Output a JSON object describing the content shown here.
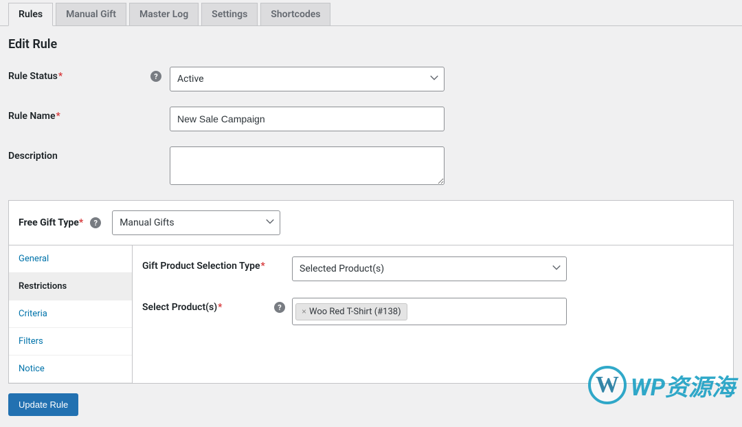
{
  "tabs": [
    {
      "label": "Rules",
      "active": true
    },
    {
      "label": "Manual Gift",
      "active": false
    },
    {
      "label": "Master Log",
      "active": false
    },
    {
      "label": "Settings",
      "active": false
    },
    {
      "label": "Shortcodes",
      "active": false
    }
  ],
  "page_title": "Edit Rule",
  "fields": {
    "rule_status": {
      "label": "Rule Status",
      "value": "Active"
    },
    "rule_name": {
      "label": "Rule Name",
      "value": "New Sale Campaign"
    },
    "description": {
      "label": "Description",
      "value": ""
    }
  },
  "panel": {
    "free_gift_type": {
      "label": "Free Gift Type",
      "value": "Manual Gifts"
    },
    "subtabs": [
      {
        "label": "General",
        "active": false
      },
      {
        "label": "Restrictions",
        "active": true
      },
      {
        "label": "Criteria",
        "active": false
      },
      {
        "label": "Filters",
        "active": false
      },
      {
        "label": "Notice",
        "active": false
      }
    ],
    "gift_selection_type": {
      "label": "Gift Product Selection Type",
      "value": "Selected Product(s)"
    },
    "select_products": {
      "label": "Select Product(s)",
      "tags": [
        "Woo Red T-Shirt (#138)"
      ]
    }
  },
  "update_button": "Update Rule",
  "watermark": "WP资源海"
}
